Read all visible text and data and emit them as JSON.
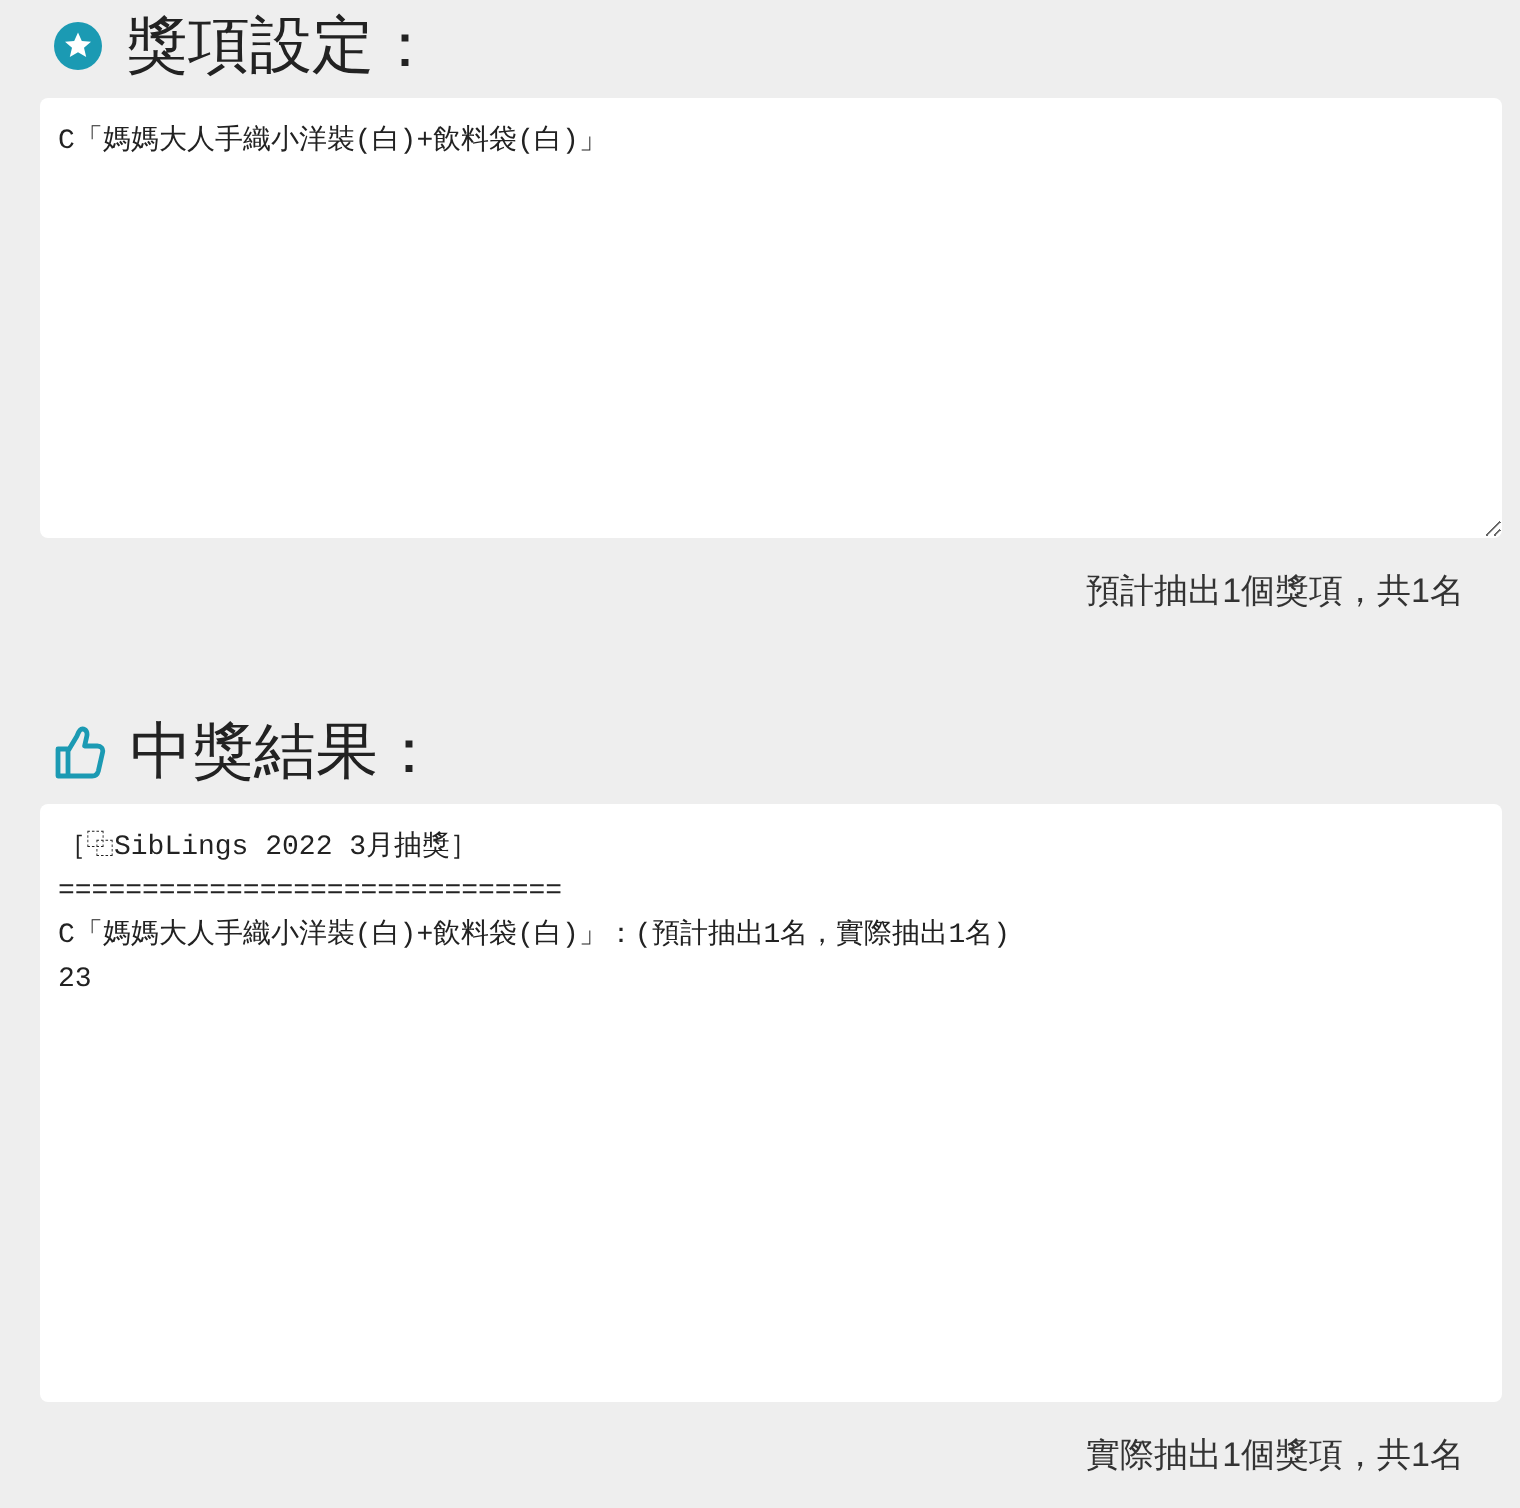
{
  "sections": [
    {
      "kind": "settings",
      "title": "獎項設定：",
      "field": {
        "lines": [
          "C「媽媽大人手織小洋裝(白)+飲料袋(白)」"
        ],
        "resizable": true
      },
      "summary": "預計抽出1個獎項，共1名"
    },
    {
      "kind": "results",
      "title": "中獎結果：",
      "field": {
        "lines": [
          "［⿻SibLings 2022 3月抽獎］",
          "==============================",
          "C「媽媽大人手織小洋裝(白)+飲料袋(白)」：(預計抽出1名，實際抽出1名)",
          "23"
        ],
        "resizable": false
      },
      "summary": "實際抽出1個獎項，共1名"
    }
  ]
}
